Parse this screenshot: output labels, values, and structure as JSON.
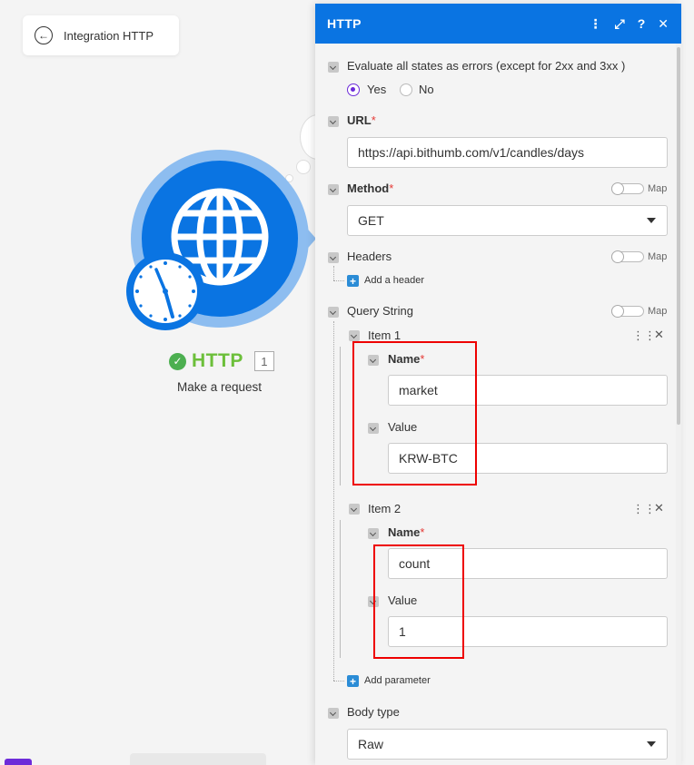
{
  "canvas": {
    "back_label": "Integration HTTP",
    "module_name": "HTTP",
    "module_count": "1",
    "module_action": "Make a request"
  },
  "panel": {
    "title": "HTTP",
    "icons": [
      "more-vert-icon",
      "expand-icon",
      "help-icon",
      "close-icon"
    ],
    "evaluate": {
      "label": "Evaluate all states as errors (except for 2xx and 3xx )",
      "yes": "Yes",
      "no": "No",
      "selected": "Yes"
    },
    "url": {
      "label": "URL",
      "value": "https://api.bithumb.com/v1/candles/days"
    },
    "method": {
      "label": "Method",
      "value": "GET",
      "map": "Map"
    },
    "headers": {
      "label": "Headers",
      "map": "Map",
      "add": "Add a header"
    },
    "query": {
      "label": "Query String",
      "map": "Map",
      "items": [
        {
          "title": "Item 1",
          "name_label": "Name",
          "name_value": "market",
          "value_label": "Value",
          "value_value": "KRW-BTC"
        },
        {
          "title": "Item 2",
          "name_label": "Name",
          "name_value": "count",
          "value_label": "Value",
          "value_value": "1"
        }
      ],
      "add": "Add parameter"
    },
    "body_type": {
      "label": "Body type",
      "value": "Raw"
    }
  },
  "colors": {
    "header_blue": "#0a74e2",
    "accent_purple": "#6d2bd9",
    "success_green": "#6cbf3a",
    "highlight_red": "#e00000"
  }
}
